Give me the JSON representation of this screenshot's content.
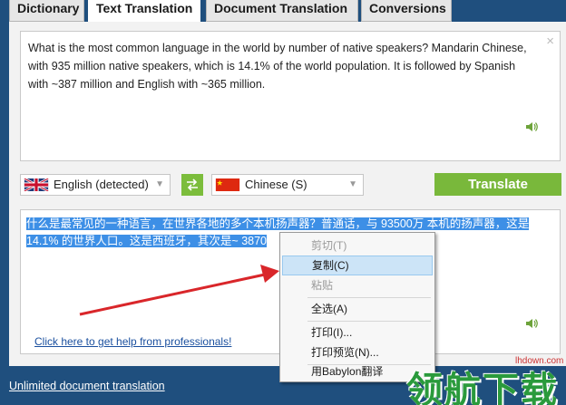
{
  "tabs": [
    {
      "label": "Dictionary",
      "active": false
    },
    {
      "label": "Text Translation",
      "active": true
    },
    {
      "label": "Document Translation",
      "active": false
    },
    {
      "label": "Conversions",
      "active": false
    }
  ],
  "source": {
    "text": "What is the most common language in the world by number of native speakers? Mandarin Chinese, with 935 million native speakers, which is 14.1% of the world population. It is followed by Spanish with ~387 million and English with ~365 million.",
    "close_icon": "close-icon",
    "speaker_icon": "speaker-icon"
  },
  "languages": {
    "from": {
      "label": "English (detected)",
      "flag": "uk-flag-icon"
    },
    "swap_icon": "swap-arrows-icon",
    "to": {
      "label": "Chinese (S)",
      "flag": "china-flag-icon"
    }
  },
  "translate_button": "Translate",
  "target": {
    "line1": "什么是最常见的一种语言，在世界各地的多个本机扬声器？普通话，与 93500万 本机的扬声器，这是",
    "line2": "14.1% 的世界人口。这是西班牙，其次是~ 3870"
  },
  "help_link": "Click here to get help from professionals!",
  "unlimited_link": "Unlimited document translation",
  "context_menu": [
    {
      "label": "剪切(T)",
      "state": "disabled"
    },
    {
      "label": "复制(C)",
      "state": "hover"
    },
    {
      "label": "粘贴",
      "state": "disabled"
    },
    {
      "label": "全选(A)",
      "state": "normal"
    },
    {
      "label": "打印(I)...",
      "state": "normal"
    },
    {
      "label": "打印预览(N)...",
      "state": "normal"
    },
    {
      "label": "用Babylon翻译",
      "state": "normal"
    }
  ],
  "watermark": {
    "url": "lhdown.com",
    "brand": "领航下载"
  },
  "colors": {
    "background": "#1f4f7e",
    "accent_green": "#79b83b",
    "selection": "#3d8fe6",
    "annotation_arrow": "#d9262a"
  }
}
